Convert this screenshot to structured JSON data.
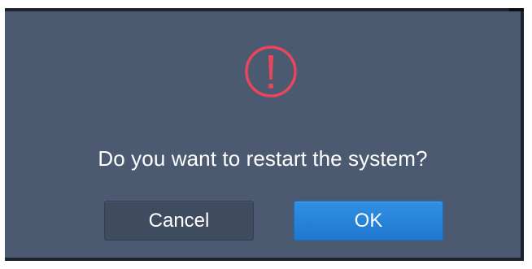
{
  "dialog": {
    "message": "Do you want to restart the system?",
    "icon": "warning-exclamation-icon",
    "icon_color": "#e9455c",
    "cancel_label": "Cancel",
    "ok_label": "OK"
  },
  "colors": {
    "dialog_background": "#4b5a71",
    "cancel_button": "#3f4c5f",
    "ok_button": "#2584d9",
    "text": "#ffffff"
  }
}
